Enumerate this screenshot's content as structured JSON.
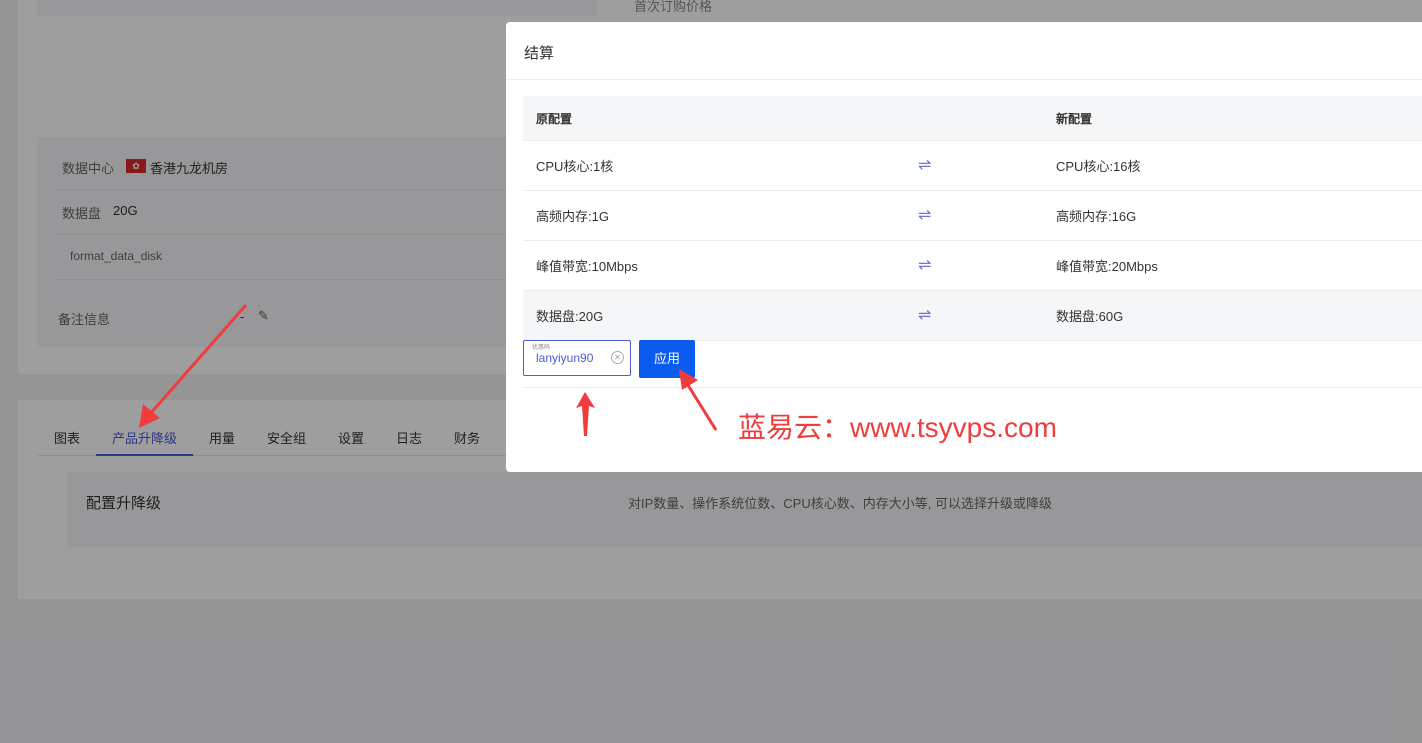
{
  "background": {
    "top_partial_label": "首次订购价格",
    "details": {
      "datacenter_label": "数据中心",
      "datacenter_value": "香港九龙机房",
      "data_disk_label": "数据盘",
      "data_disk_value": "20G",
      "disk_option": "format_data_disk",
      "remark_label": "备注信息",
      "remark_value": "-"
    },
    "tabs": [
      {
        "label": "图表"
      },
      {
        "label": "产品升降级"
      },
      {
        "label": "用量"
      },
      {
        "label": "安全组"
      },
      {
        "label": "设置"
      },
      {
        "label": "日志"
      },
      {
        "label": "财务"
      }
    ],
    "active_tab": "产品升降级",
    "upgrade_section": {
      "title": "配置升降级",
      "description": "对IP数量、操作系统位数、CPU核心数、内存大小等, 可以选择升级或降级"
    }
  },
  "modal": {
    "title": "结算",
    "columns": {
      "old": "原配置",
      "new": "新配置"
    },
    "rows": [
      {
        "old": "CPU核心:1核",
        "new": "CPU核心:16核"
      },
      {
        "old": "高频内存:1G",
        "new": "高频内存:16G"
      },
      {
        "old": "峰值带宽:10Mbps",
        "new": "峰值带宽:20Mbps"
      },
      {
        "old": "数据盘:20G",
        "new": "数据盘:60G"
      }
    ],
    "swap_symbol": "⇌",
    "coupon": {
      "floating_label": "优惠码",
      "value": "lanyiyun90"
    },
    "apply_label": "应用"
  },
  "watermark": "蓝易云：www.tsyvps.com",
  "colors": {
    "accent": "#4d5bd6",
    "apply_button": "#0a5cf0",
    "annotation_red": "#ef3c3c"
  }
}
